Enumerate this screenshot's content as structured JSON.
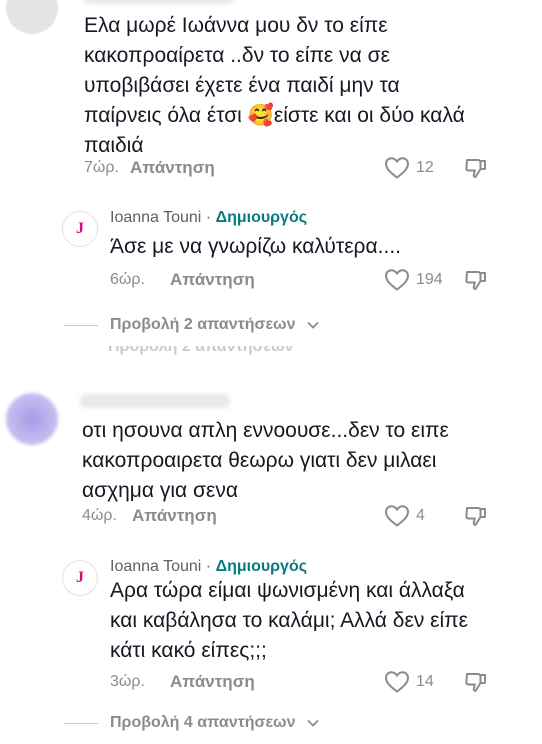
{
  "comments": [
    {
      "text": "Ελα μωρέ Ιωάννα μου δν το είπε\nκακοπροαίρετα ..δν το είπε να σε\nυποβιβάσει έχετε ένα παιδί μην τα\nπαίρνεις όλα έτσι 🥰είστε και οι δύο καλά\nπαιδιά",
      "time": "7ώρ.",
      "reply_label": "Απάντηση",
      "likes": "12"
    },
    {
      "text": "οτι ησουνα απλη εννοουσε...δεν το ειπε\nκακοπροαιρετα θεωρω γιατι δεν μιλαει\nασχημα για σενα",
      "time": "4ώρ.",
      "reply_label": "Απάντηση",
      "likes": "4"
    }
  ],
  "replies": [
    {
      "author": "Ioanna Touni",
      "separator": " · ",
      "badge": "Δημιουργός",
      "avatar_letter": "J",
      "text": "Άσε με να γνωρίζω καλύτερα....",
      "time": "6ώρ.",
      "reply_label": "Απάντηση",
      "likes": "194"
    },
    {
      "author": "Ioanna Touni",
      "separator": " · ",
      "badge": "Δημιουργός",
      "avatar_letter": "J",
      "text": "Αρα τώρα είμαι ψωνισμένη και άλλαξα\nκαι καβάλησα το καλάμι; Αλλά δεν είπε\nκάτι κακό είπες;;;",
      "time": "3ώρ.",
      "reply_label": "Απάντηση",
      "likes": "14"
    }
  ],
  "view_replies": [
    "Προβολή 2 απαντήσεων",
    "Προβολή 4 απαντήσεων"
  ],
  "icons": {
    "heart": "heart-outline-icon",
    "dislike": "thumbs-down-icon",
    "chevron": "chevron-down-icon"
  },
  "colors": {
    "creator_badge": "#0a7a80",
    "logo_letter": "#d0117a",
    "muted": "#8a8b91"
  }
}
